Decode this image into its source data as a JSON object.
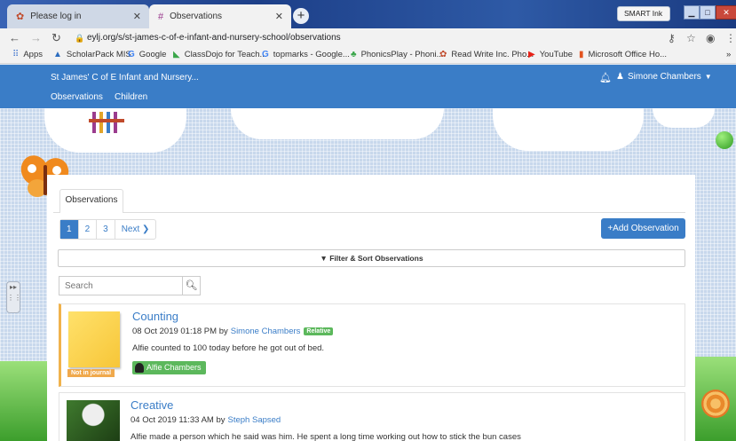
{
  "browser": {
    "tabs": [
      {
        "title": "Please log in",
        "icon": "eylj-logo-icon",
        "active": false
      },
      {
        "title": "Observations",
        "icon": "eylj-logo-icon",
        "active": true
      }
    ],
    "new_tab_label": "+",
    "url": "eylj.org/s/st-james-c-of-e-infant-and-nursery-school/observations",
    "smart_ink": "SMART Ink",
    "bookmarks": [
      {
        "label": "Apps",
        "icon": "apps-grid-icon"
      },
      {
        "label": "ScholarPack MIS",
        "icon": "scholarpack-icon"
      },
      {
        "label": "Google",
        "icon": "google-icon"
      },
      {
        "label": "ClassDojo for Teach...",
        "icon": "classdojo-icon"
      },
      {
        "label": "topmarks - Google...",
        "icon": "google-icon"
      },
      {
        "label": "PhonicsPlay - Phoni...",
        "icon": "phonicsplay-icon"
      },
      {
        "label": "Read Write Inc. Pho...",
        "icon": "readwriteinc-icon"
      },
      {
        "label": "YouTube",
        "icon": "youtube-icon"
      },
      {
        "label": "Microsoft Office Ho...",
        "icon": "office-icon"
      }
    ],
    "bookmarks_more": "»"
  },
  "site": {
    "brand": "St James' C of E Infant and Nursery...",
    "nav": [
      "Observations",
      "Children"
    ],
    "user": "Simone Chambers"
  },
  "main": {
    "tab_label": "Observations",
    "pagination": {
      "pages": [
        "1",
        "2",
        "3"
      ],
      "current": "1",
      "next": "Next"
    },
    "add_button": "+Add Observation",
    "filter_label": "Filter & Sort Observations",
    "search_placeholder": "Search",
    "observations": [
      {
        "title": "Counting",
        "date": "08 Oct 2019 01:18 PM by",
        "author": "Simone Chambers",
        "badge": "Relative",
        "text": "Alfie counted to 100 today before he got out of bed.",
        "journal_status": "Not in journal",
        "child": "Alfie Chambers"
      },
      {
        "title": "Creative",
        "date": "04 Oct 2019 11:33 AM by",
        "author": "Steph Sapsed",
        "text": "Alfie made a person which he said was him. He spent a long time working out how to stick the bun cases"
      }
    ]
  },
  "colors": {
    "brand_blue": "#3a7dc7",
    "badge_green": "#5cb85c",
    "journal_orange": "#f0a94c"
  }
}
